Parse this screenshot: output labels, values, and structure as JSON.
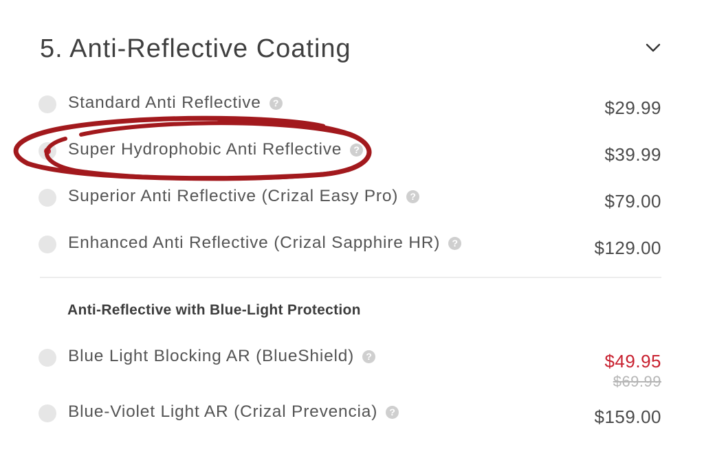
{
  "section": {
    "title": "5. Anti-Reflective Coating",
    "toggle_icon": "chevron-down-icon"
  },
  "options": [
    {
      "label": "Standard Anti Reflective",
      "price": "$29.99",
      "selected": false
    },
    {
      "label": "Super Hydrophobic Anti Reflective",
      "price": "$39.99",
      "selected": true
    },
    {
      "label": "Superior Anti Reflective (Crizal Easy Pro)",
      "price": "$79.00",
      "selected": false
    },
    {
      "label": "Enhanced Anti Reflective (Crizal Sapphire HR)",
      "price": "$129.00",
      "selected": false
    }
  ],
  "blue_light_group": {
    "heading": "Anti-Reflective with Blue-Light Protection",
    "options": [
      {
        "label": "Blue Light Blocking AR (BlueShield)",
        "price": "$49.95",
        "old_price": "$69.99",
        "selected": false
      },
      {
        "label": "Blue-Violet Light AR (Crizal Prevencia)",
        "price": "$159.00",
        "selected": false
      }
    ]
  },
  "help_glyph": "?",
  "colors": {
    "accent_red": "#c8202f",
    "annotation_red": "#a2191d",
    "radio_bg": "#e6e6e6",
    "help_bg": "#cfcfcf",
    "strike_gray": "#b5b5b5"
  }
}
